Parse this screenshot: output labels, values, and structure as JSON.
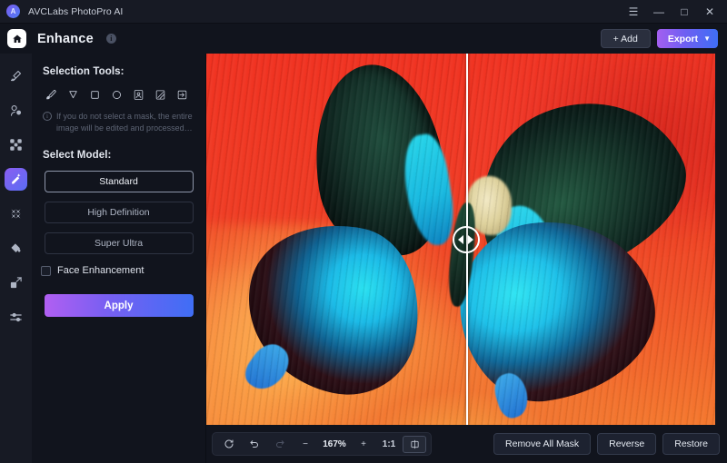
{
  "window": {
    "app_name": "AVCLabs PhotoPro AI",
    "logo_letter": "A",
    "controls": [
      {
        "name": "menu-button",
        "glyph": "☰"
      },
      {
        "name": "minimize-button",
        "glyph": "—"
      },
      {
        "name": "maximize-button",
        "glyph": "□"
      },
      {
        "name": "close-button",
        "glyph": "✕"
      }
    ]
  },
  "header": {
    "home_icon": "home-icon",
    "title": "Enhance",
    "info_glyph": "i",
    "add_label": "+ Add",
    "export_label": "Export",
    "export_chevron": "⌄"
  },
  "rail": {
    "items": [
      {
        "name": "sidebar-item-retouch",
        "icon": "eraser-icon",
        "active": false
      },
      {
        "name": "sidebar-item-object-removal",
        "icon": "object-remove-icon",
        "active": false
      },
      {
        "name": "sidebar-item-background",
        "icon": "checker-icon",
        "active": false
      },
      {
        "name": "sidebar-item-enhance",
        "icon": "magic-wand-icon",
        "active": true
      },
      {
        "name": "sidebar-item-upscale",
        "icon": "expand-arrows-icon",
        "active": false
      },
      {
        "name": "sidebar-item-colorize",
        "icon": "paint-bucket-icon",
        "active": false
      },
      {
        "name": "sidebar-item-resize",
        "icon": "resize-icon",
        "active": false
      },
      {
        "name": "sidebar-item-adjust",
        "icon": "sliders-icon",
        "active": false
      }
    ]
  },
  "panel": {
    "selection_tools_label": "Selection Tools:",
    "tools": [
      {
        "name": "brush-tool",
        "icon": "brush-icon"
      },
      {
        "name": "lasso-tool",
        "icon": "cursor-arrow-icon"
      },
      {
        "name": "rectangle-select-tool",
        "icon": "square-icon"
      },
      {
        "name": "ellipse-select-tool",
        "icon": "circle-icon"
      },
      {
        "name": "portrait-select-tool",
        "icon": "person-frame-icon"
      },
      {
        "name": "subject-select-tool",
        "icon": "hatched-frame-icon"
      },
      {
        "name": "invert-select-tool",
        "icon": "arrow-into-box-icon"
      }
    ],
    "hint_icon": "i",
    "hint_text": "If you do not select a mask, the entire image will be edited and processed…",
    "select_model_label": "Select Model:",
    "models": [
      {
        "name": "model-standard",
        "label": "Standard",
        "selected": true
      },
      {
        "name": "model-high-definition",
        "label": "High Definition",
        "selected": false
      },
      {
        "name": "model-super-ultra",
        "label": "Super Ultra",
        "selected": false
      }
    ],
    "face_enhancement_label": "Face Enhancement",
    "face_enhancement_checked": false,
    "apply_label": "Apply"
  },
  "canvas": {
    "divider_position_pct": 51,
    "handle_left_arrow": "left-arrow",
    "handle_right_arrow": "right-arrow"
  },
  "bottombar": {
    "tools": [
      {
        "name": "reset-button",
        "icon": "rotate-icon",
        "label": "",
        "dim": false
      },
      {
        "name": "undo-button",
        "icon": "undo-icon",
        "label": "",
        "dim": false
      },
      {
        "name": "redo-button",
        "icon": "redo-icon",
        "label": "",
        "dim": true
      },
      {
        "name": "zoom-out-button",
        "icon": "minus-icon",
        "label": "−",
        "dim": false
      }
    ],
    "zoom_level": "167%",
    "zoom_in_label": "+",
    "ratio_label": "1:1",
    "compare_icon": "split-view-icon",
    "actions": [
      {
        "name": "remove-all-mask-button",
        "label": "Remove All Mask"
      },
      {
        "name": "reverse-button",
        "label": "Reverse"
      },
      {
        "name": "restore-button",
        "label": "Restore"
      }
    ]
  },
  "colors": {
    "accent_purple": "#a45ff0",
    "accent_blue": "#3f6ef5",
    "panel_bg": "#11141d",
    "rail_bg": "#171a24"
  }
}
